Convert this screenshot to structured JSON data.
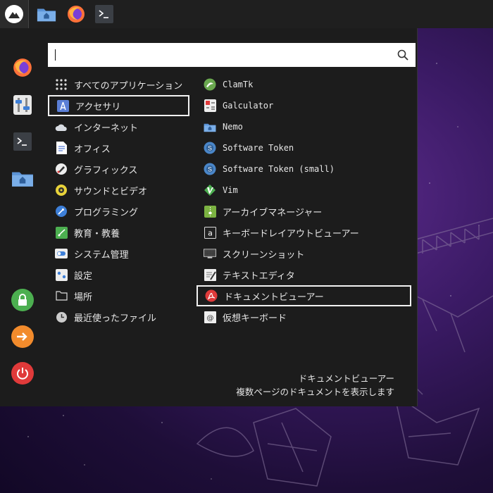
{
  "panel": {
    "launcher_icon": "distro-mountain-logo",
    "buttons": [
      {
        "name": "file-manager-icon"
      },
      {
        "name": "firefox-icon"
      },
      {
        "name": "terminal-icon"
      }
    ]
  },
  "sidebar": {
    "items": [
      "firefox-icon",
      "settings-icon",
      "terminal-icon",
      "home-folder-icon",
      "lock-icon",
      "logout-icon",
      "power-icon"
    ]
  },
  "search": {
    "value": "",
    "placeholder": ""
  },
  "categories": [
    {
      "label": "すべてのアプリケーション",
      "icon": "grid-icon"
    },
    {
      "label": "アクセサリ",
      "icon": "accessories-icon",
      "selected": true
    },
    {
      "label": "インターネット",
      "icon": "cloud-icon"
    },
    {
      "label": "オフィス",
      "icon": "document-icon"
    },
    {
      "label": "グラフィックス",
      "icon": "graphics-icon"
    },
    {
      "label": "サウンドとビデオ",
      "icon": "multimedia-icon"
    },
    {
      "label": "プログラミング",
      "icon": "programming-icon"
    },
    {
      "label": "教育・教養",
      "icon": "education-icon"
    },
    {
      "label": "システム管理",
      "icon": "system-toggle-icon"
    },
    {
      "label": "設定",
      "icon": "settings-icon"
    },
    {
      "label": "場所",
      "icon": "folder-icon"
    },
    {
      "label": "最近使ったファイル",
      "icon": "clock-icon"
    }
  ],
  "apps": [
    {
      "label": "ClamTk",
      "icon": "clamtk-icon",
      "mono": true
    },
    {
      "label": "Galculator",
      "icon": "calculator-icon",
      "mono": true
    },
    {
      "label": "Nemo",
      "icon": "folder-icon",
      "mono": true
    },
    {
      "label": "Software Token",
      "icon": "token-icon",
      "mono": true
    },
    {
      "label": "Software Token (small)",
      "icon": "token-icon",
      "mono": true
    },
    {
      "label": "Vim",
      "icon": "vim-icon",
      "mono": true
    },
    {
      "label": "アーカイブマネージャー",
      "icon": "archive-icon"
    },
    {
      "label": "キーボードレイアウトビューアー",
      "icon": "keyboard-layout-icon"
    },
    {
      "label": "スクリーンショット",
      "icon": "screenshot-icon"
    },
    {
      "label": "テキストエディタ",
      "icon": "text-editor-icon"
    },
    {
      "label": "ドキュメントビューアー",
      "icon": "pdf-viewer-icon",
      "selected": true
    },
    {
      "label": "仮想キーボード",
      "icon": "virtual-keyboard-icon"
    }
  ],
  "description": {
    "title": "ドキュメントビューアー",
    "text": "複数ページのドキュメントを表示します"
  },
  "colors": {
    "menu_bg": "#1c1c1c",
    "panel_bg": "#1f1f1f",
    "text": "#e6e6e6",
    "selection_border": "#f2f2f2",
    "desktop_purple": "#3a1a64"
  }
}
